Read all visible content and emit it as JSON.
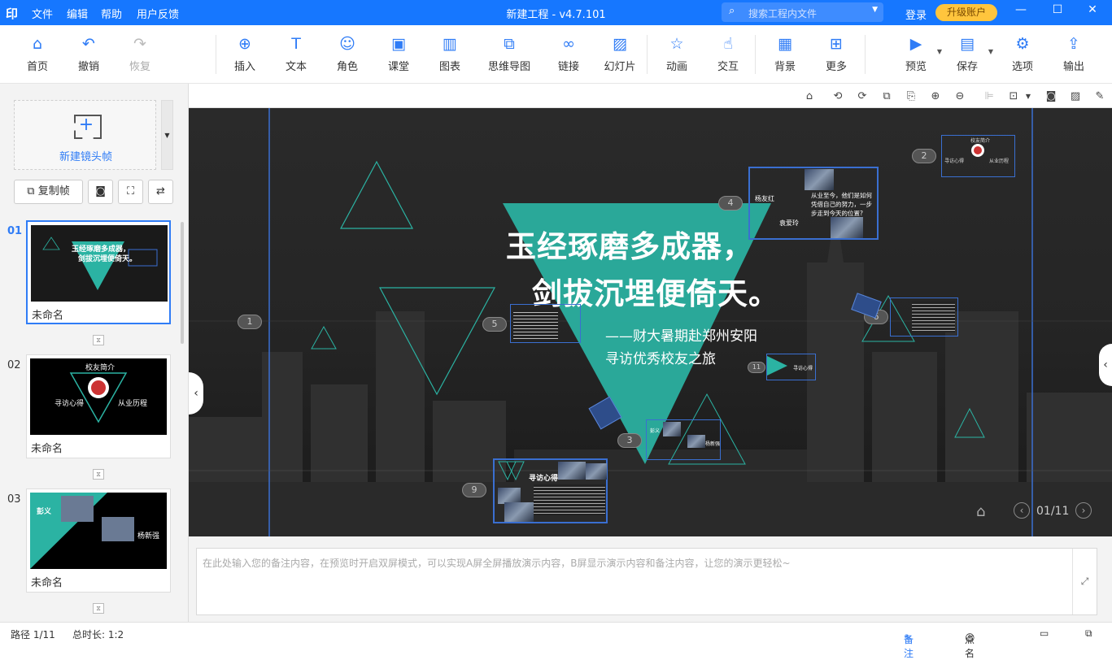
{
  "titlebar": {
    "logo": "印",
    "menus": [
      "文件",
      "编辑",
      "帮助",
      "用户反馈"
    ],
    "title": "新建工程 - v4.7.101",
    "search_placeholder": "搜索工程内文件",
    "login": "登录",
    "upgrade": "升级账户",
    "win_min": "—",
    "win_max": "☐",
    "win_close": "✕"
  },
  "toolbar": {
    "home": "首页",
    "undo": "撤销",
    "redo": "恢复",
    "insert": "插入",
    "text": "文本",
    "role": "角色",
    "classroom": "课堂",
    "chart": "图表",
    "mindmap": "思维导图",
    "link": "链接",
    "slideshow": "幻灯片",
    "animation": "动画",
    "interaction": "交互",
    "background": "背景",
    "more": "更多",
    "preview": "预览",
    "save": "保存",
    "options": "选项",
    "export": "输出"
  },
  "leftpanel": {
    "new_frame": "新建镜头帧",
    "copy_frame": "复制帧",
    "slides": [
      {
        "num": "01",
        "name": "未命名",
        "thumb_title1": "玉经琢磨多成器，",
        "thumb_title2": "剑拔沉埋便倚天。"
      },
      {
        "num": "02",
        "name": "未命名",
        "thumb_title": "校友简介",
        "thumb_left": "寻访心得",
        "thumb_right": "从业历程"
      },
      {
        "num": "03",
        "name": "未命名",
        "thumb_left": "彭义",
        "thumb_right": "杨新强"
      }
    ]
  },
  "canvas": {
    "headline1": "玉经琢磨多成器，",
    "headline2": "剑拔沉埋便倚天。",
    "sub1": "——财大暑期赴郑州安阳",
    "sub2": "寻访优秀校友之旅",
    "path_nodes": [
      "1",
      "2",
      "3",
      "4",
      "5",
      "6",
      "9",
      "11"
    ],
    "frame4_name1": "杨友红",
    "frame4_name2": "袁爱玲",
    "frame4_quote": "从业至今，他们是如何凭借自己的努力，一步步走到今天的位置?",
    "frame2_title": "校友简介",
    "frame2_left": "寻访心得",
    "frame2_right": "从业历程",
    "frame9_title": "寻访心得",
    "frame3_left": "彭义",
    "frame3_right": "杨新强",
    "frame11_label": "寻访心得",
    "page_indicator": "01/11"
  },
  "notes": {
    "placeholder": "在此处输入您的备注内容，在预览时开启双屏模式，可以实现A屏全屏播放演示内容，B屏显示演示内容和备注内容，让您的演示更轻松~"
  },
  "statusbar": {
    "path": "路径 1/11",
    "duration": "总时长: 1:2",
    "notes_btn": "备注",
    "rollcall_btn": "点名"
  },
  "colors": {
    "accent": "#1677ff",
    "teal": "#2bb3a3",
    "upgrade": "#ffc53d"
  }
}
